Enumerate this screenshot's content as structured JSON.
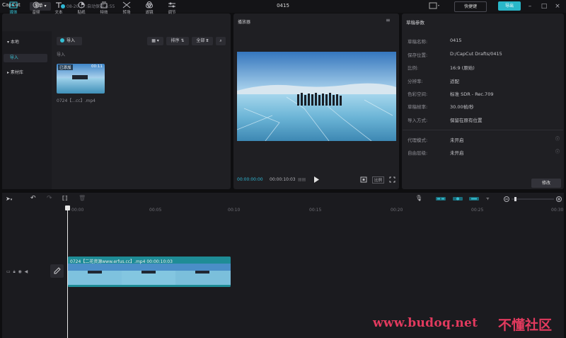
{
  "titlebar": {
    "app_name": "CapCut",
    "menu_label": "菜单",
    "autosave": "08-20 17:自动保存 4:55",
    "project_title": "0415",
    "shortcut_label": "快捷键",
    "export_label": "导出"
  },
  "tool_tabs": [
    {
      "label": "媒体",
      "icon": "media-icon"
    },
    {
      "label": "音频",
      "icon": "audio-icon"
    },
    {
      "label": "文本",
      "icon": "text-icon"
    },
    {
      "label": "贴纸",
      "icon": "sticker-icon"
    },
    {
      "label": "特效",
      "icon": "effects-icon"
    },
    {
      "label": "转场",
      "icon": "transition-icon"
    },
    {
      "label": "滤镜",
      "icon": "filter-icon"
    },
    {
      "label": "调节",
      "icon": "adjust-icon"
    }
  ],
  "side_nav": {
    "local": "本地",
    "import": "导入",
    "library": "素材库"
  },
  "media": {
    "import_label": "导入",
    "sort_label": "排序",
    "all_label": "全部",
    "section_label": "导入",
    "clip_badge": "已添加",
    "clip_duration": "00:11",
    "clip_name": "0724【...cc】.mp4"
  },
  "player": {
    "title": "播放器",
    "current_time": "00:00:00:00",
    "total_time": "00:00:10:03",
    "ratio_label": "比例"
  },
  "params": {
    "title": "草稿参数",
    "rows": [
      {
        "label": "草稿名称:",
        "value": "0415"
      },
      {
        "label": "保存位置:",
        "value": "D:/CapCut Drafts/0415"
      },
      {
        "label": "比例:",
        "value": "16:9 (原始)"
      },
      {
        "label": "分辨率:",
        "value": "适配"
      },
      {
        "label": "色彩空间:",
        "value": "标准 SDR - Rec.709"
      },
      {
        "label": "草稿帧率:",
        "value": "30.00帧/秒"
      },
      {
        "label": "导入方式:",
        "value": "保留在原有位置"
      }
    ],
    "extra_rows": [
      {
        "label": "代理模式:",
        "value": "未开启"
      },
      {
        "label": "自由层级:",
        "value": "未开启"
      }
    ],
    "modify_label": "修改"
  },
  "timeline": {
    "ruler": [
      "00:00",
      "00:05",
      "00:10",
      "00:15",
      "00:20",
      "00:25",
      "00:30"
    ],
    "clip_label": "0724【二花资源www.erfus.cc】.mp4   00:00:10:03"
  },
  "watermark": {
    "url": "www.budoq.net",
    "cn": "不懂社区"
  },
  "colors": {
    "accent": "#2fb6d2",
    "clip_track": "#1e8c96",
    "watermark": "#e23a5e"
  }
}
